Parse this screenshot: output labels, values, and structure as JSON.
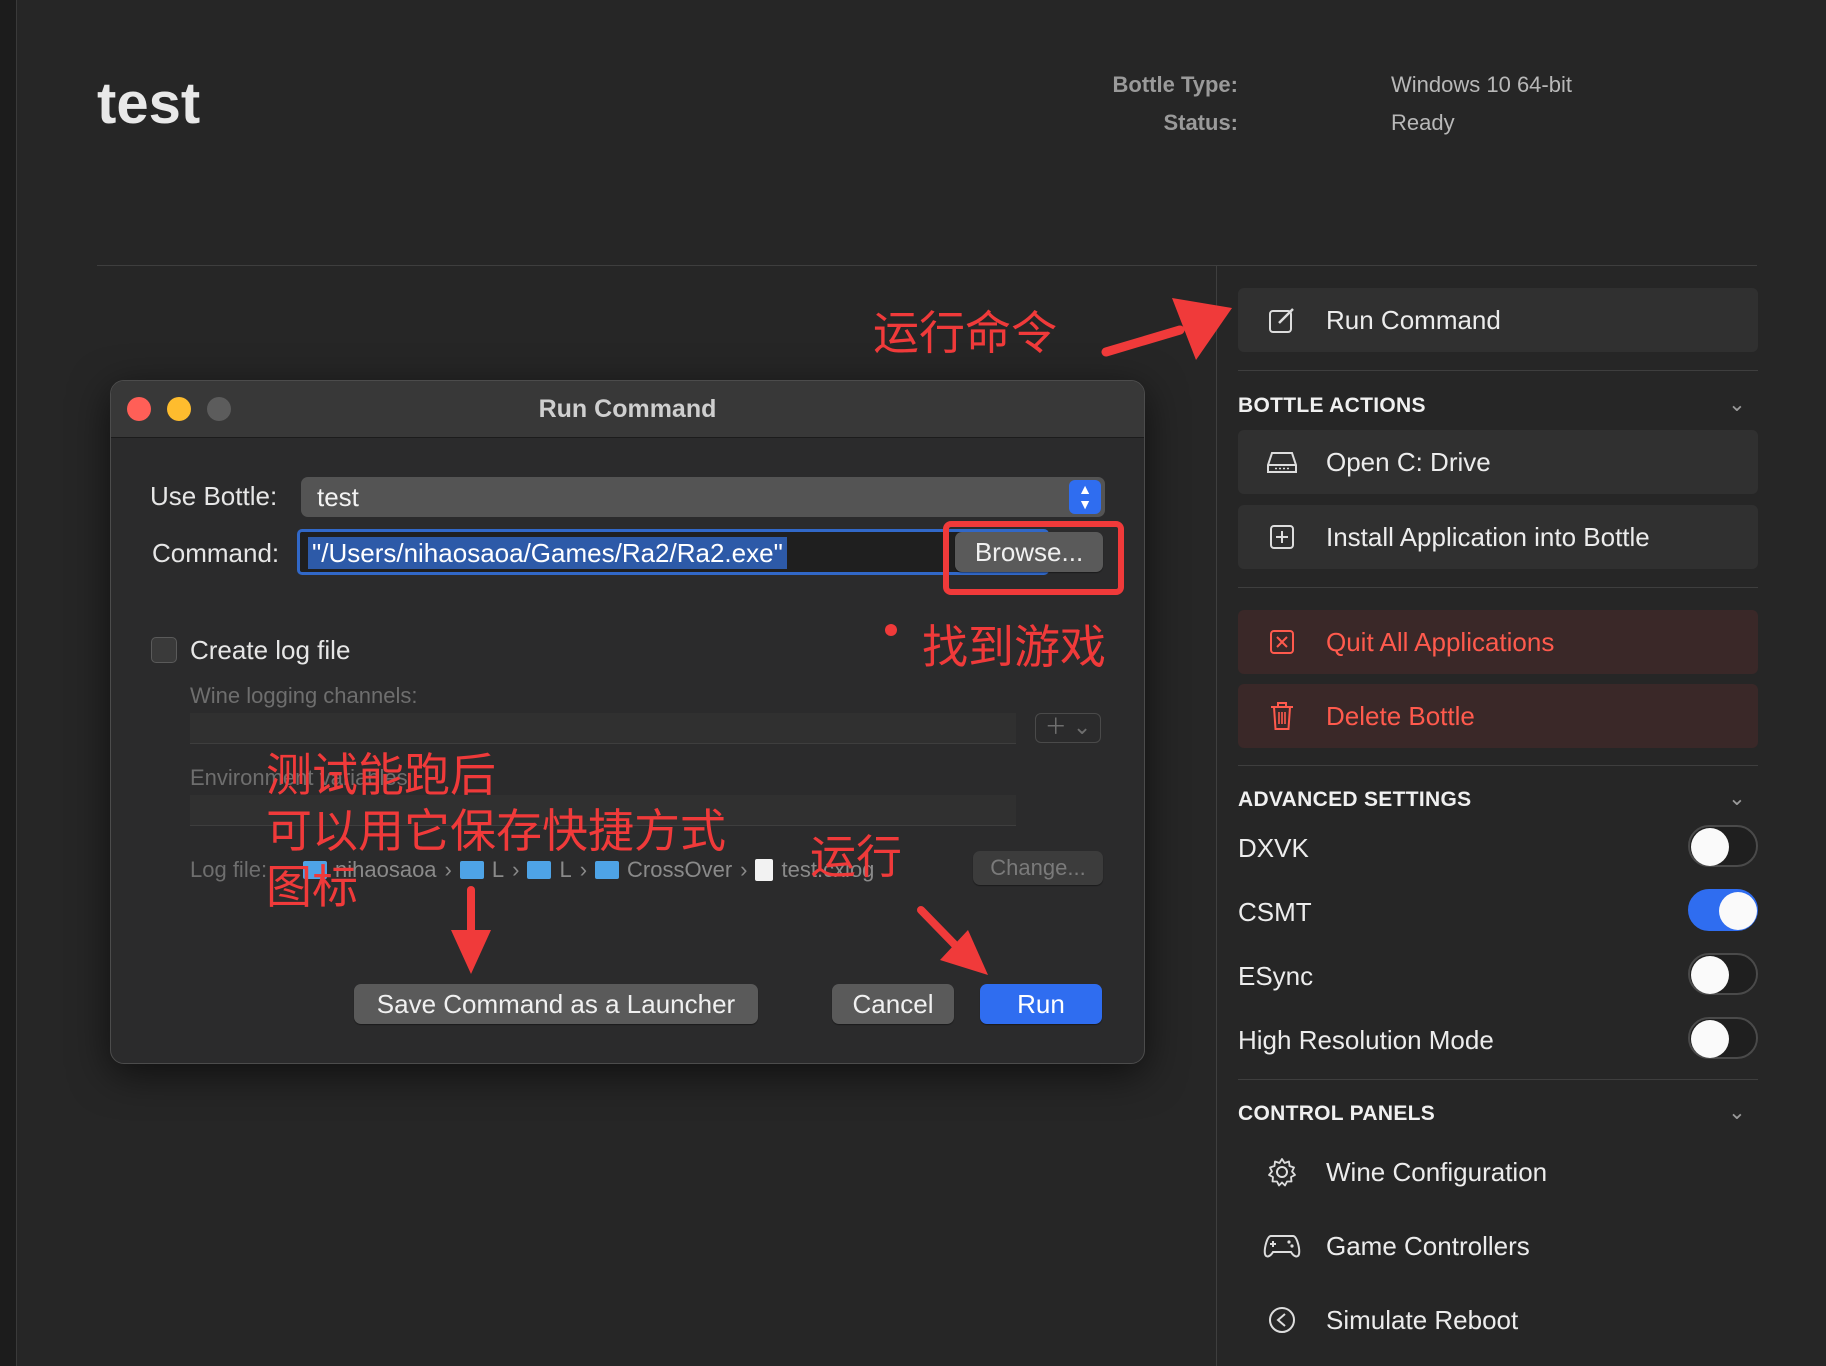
{
  "header": {
    "title": "test",
    "bottle_type_label": "Bottle Type:",
    "bottle_type_value": "Windows 10 64-bit",
    "status_label": "Status:",
    "status_value": "Ready"
  },
  "sidebar": {
    "run_command": "Run Command",
    "bottle_actions": {
      "heading": "BOTTLE ACTIONS",
      "open_c_drive": "Open C: Drive",
      "install_application": "Install Application into Bottle",
      "quit_all": "Quit All Applications",
      "delete_bottle": "Delete Bottle"
    },
    "advanced_settings": {
      "heading": "ADVANCED SETTINGS",
      "toggles": [
        {
          "label": "DXVK",
          "on": false
        },
        {
          "label": "CSMT",
          "on": true
        },
        {
          "label": "ESync",
          "on": false
        },
        {
          "label": "High Resolution Mode",
          "on": false
        }
      ]
    },
    "control_panels": {
      "heading": "CONTROL PANELS",
      "wine_configuration": "Wine Configuration",
      "game_controllers": "Game Controllers",
      "simulate_reboot": "Simulate Reboot"
    },
    "chevron": "⌄"
  },
  "dialog": {
    "title": "Run Command",
    "use_bottle_label": "Use Bottle:",
    "use_bottle_value": "test",
    "command_label": "Command:",
    "command_value": "\"/Users/nihaosaoa/Games/Ra2/Ra2.exe\"",
    "browse": "Browse...",
    "create_log_label": "Create log file",
    "create_log_checked": false,
    "wine_logging_label": "Wine logging channels:",
    "env_vars_label": "Environment variables",
    "log_file_label": "Log file:",
    "log_path": [
      "nihaosaoa",
      "L",
      "L",
      "CrossOver",
      "test.cxlog"
    ],
    "path_separator": "›",
    "change": "Change...",
    "save_launcher": "Save Command as a Launcher",
    "cancel": "Cancel",
    "run": "Run"
  },
  "annotations": {
    "run_command_note": "运行命令",
    "find_game_note": "找到游戏",
    "save_note_line1": "测试能跑后",
    "save_note_line2": "可以用它保存快捷方式",
    "save_note_line3": "图标",
    "run_note": "运行"
  },
  "colors": {
    "accent_blue": "#2f6df0",
    "destructive_red": "#ff5a4d",
    "annotation_red": "#f03a3a",
    "light_close": "#ff5f57",
    "light_minimize": "#febc2e",
    "light_zoom": "#5c5c5c"
  }
}
